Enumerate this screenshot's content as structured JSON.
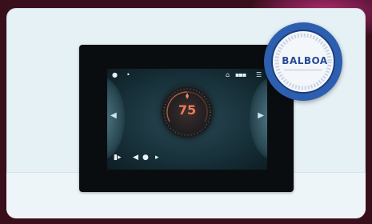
{
  "badge": {
    "brand": "BALBOA"
  },
  "thermostat": {
    "temperature": "75"
  },
  "colors": {
    "accent": "#f07a55",
    "badge_blue": "#2d5fb0",
    "card_bg": "#e6f1f6"
  },
  "icons": {
    "status_left": "spa-icon",
    "status_right": "wifi-icon",
    "heat": "flame-icon",
    "controls": [
      "light-icon",
      "pump-icon",
      "jets-icon",
      "chevron-right-icon"
    ]
  }
}
